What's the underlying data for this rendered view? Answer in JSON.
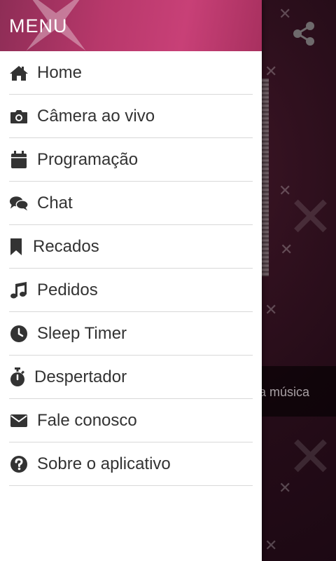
{
  "drawer": {
    "title": "MENU",
    "items": [
      {
        "label": "Home",
        "icon": "home-icon"
      },
      {
        "label": "Câmera ao vivo",
        "icon": "camera-icon"
      },
      {
        "label": "Programação",
        "icon": "calendar-icon"
      },
      {
        "label": "Chat",
        "icon": "chat-bubbles-icon"
      },
      {
        "label": "Recados",
        "icon": "bookmark-icon"
      },
      {
        "label": "Pedidos",
        "icon": "music-note-icon"
      },
      {
        "label": "Sleep Timer",
        "icon": "clock-icon"
      },
      {
        "label": "Despertador",
        "icon": "stopwatch-icon"
      },
      {
        "label": "Fale conosco",
        "icon": "envelope-icon"
      },
      {
        "label": "Sobre o aplicativo",
        "icon": "question-circle-icon"
      }
    ]
  },
  "background": {
    "now_playing_text": "a música",
    "share_icon": "share-icon"
  },
  "colors": {
    "header_accent": "#b8386b",
    "icon_color": "#333333",
    "divider": "#d8d8d8"
  }
}
